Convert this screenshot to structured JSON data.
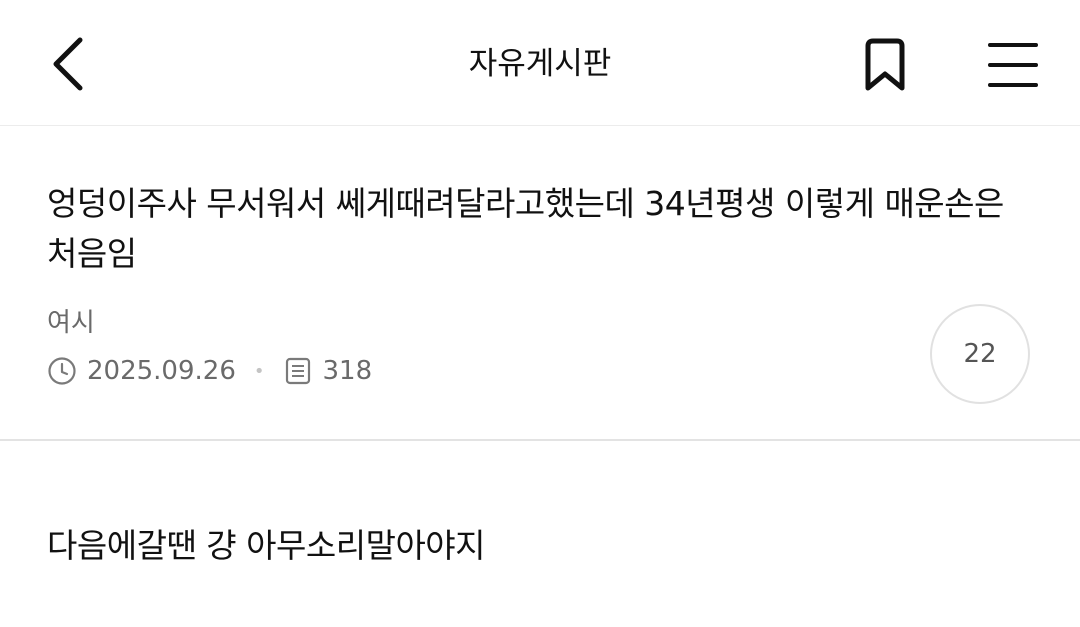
{
  "header": {
    "title": "자유게시판",
    "back_icon": "chevron-left-icon",
    "bookmark_icon": "bookmark-icon",
    "menu_icon": "hamburger-menu-icon"
  },
  "posts": [
    {
      "title": "엉덩이주사 무서워서 쎄게때려달라고했는데 34년평생 이렇게 매운손은 처음임",
      "author": "여시",
      "date": "2025.09.26",
      "views": "318",
      "comments": "22"
    },
    {
      "title": "다음에갈땐 걍 아무소리말아야지"
    }
  ],
  "colors": {
    "text": "#111111",
    "meta": "#6a6a6a",
    "divider": "#e3e3e3"
  }
}
